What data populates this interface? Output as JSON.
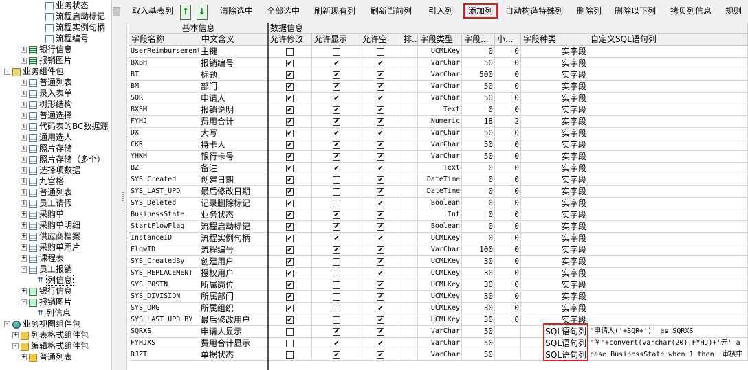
{
  "colors": {
    "highlight_border": "#e02020",
    "header_bg": "#f0f0f0",
    "grid_line": "#d8d8d8",
    "arrow_green": "#1a9a1a"
  },
  "tree": [
    {
      "label": "业务状态",
      "depth": 4,
      "icon": "table-icon",
      "expander": ""
    },
    {
      "label": "流程启动标记",
      "depth": 4,
      "icon": "table-icon",
      "expander": ""
    },
    {
      "label": "流程实例句柄",
      "depth": 4,
      "icon": "table-icon",
      "expander": ""
    },
    {
      "label": "流程编号",
      "depth": 4,
      "icon": "table-icon",
      "expander": ""
    },
    {
      "label": "银行信息",
      "depth": 2,
      "icon": "grid-icon",
      "expander": "+"
    },
    {
      "label": "报销图片",
      "depth": 2,
      "icon": "grid-icon",
      "expander": "+"
    },
    {
      "label": "业务组件包",
      "depth": 0,
      "icon": "package-icon",
      "expander": "-"
    },
    {
      "label": "普通列表",
      "depth": 2,
      "icon": "table-icon",
      "expander": "+"
    },
    {
      "label": "录入表单",
      "depth": 2,
      "icon": "table-icon",
      "expander": "+"
    },
    {
      "label": "树形结构",
      "depth": 2,
      "icon": "table-icon",
      "expander": "+"
    },
    {
      "label": "普通选择",
      "depth": 2,
      "icon": "table-icon",
      "expander": "+"
    },
    {
      "label": "代码表的BC数据源",
      "depth": 2,
      "icon": "table-icon",
      "expander": "+"
    },
    {
      "label": "通用选人",
      "depth": 2,
      "icon": "table-icon",
      "expander": "+"
    },
    {
      "label": "照片存储",
      "depth": 2,
      "icon": "table-icon",
      "expander": "+"
    },
    {
      "label": "照片存储（多个）",
      "depth": 2,
      "icon": "table-icon",
      "expander": "+"
    },
    {
      "label": "选择项数据",
      "depth": 2,
      "icon": "table-icon",
      "expander": "+"
    },
    {
      "label": "九宫格",
      "depth": 2,
      "icon": "table-icon",
      "expander": "+"
    },
    {
      "label": "普通列表",
      "depth": 2,
      "icon": "table-icon",
      "expander": "+"
    },
    {
      "label": "员工请假",
      "depth": 2,
      "icon": "table-icon",
      "expander": "+"
    },
    {
      "label": "采购单",
      "depth": 2,
      "icon": "table-icon",
      "expander": "+"
    },
    {
      "label": "采购单明细",
      "depth": 2,
      "icon": "table-icon",
      "expander": "+"
    },
    {
      "label": "供应商档案",
      "depth": 2,
      "icon": "table-icon",
      "expander": "+"
    },
    {
      "label": "采购单照片",
      "depth": 2,
      "icon": "table-icon",
      "expander": "+"
    },
    {
      "label": "课程表",
      "depth": 2,
      "icon": "table-icon",
      "expander": "+"
    },
    {
      "label": "员工报销",
      "depth": 2,
      "icon": "table-icon",
      "expander": "-"
    },
    {
      "label": "列信息",
      "depth": 3,
      "icon": "column-icon",
      "expander": "",
      "selected": true
    },
    {
      "label": "银行信息",
      "depth": 2,
      "icon": "grid-icon",
      "expander": "+"
    },
    {
      "label": "报销图片",
      "depth": 2,
      "icon": "grid-icon",
      "expander": "-"
    },
    {
      "label": "列信息",
      "depth": 3,
      "icon": "column-icon",
      "expander": ""
    },
    {
      "label": "业务视图组件包",
      "depth": 0,
      "icon": "globe-icon",
      "expander": "-"
    },
    {
      "label": "列表格式组件包",
      "depth": 1,
      "icon": "folder-icon",
      "expander": "+"
    },
    {
      "label": "编辑格式组件包",
      "depth": 1,
      "icon": "folder-icon",
      "expander": "-"
    },
    {
      "label": "普通列表",
      "depth": 2,
      "icon": "folder-icon",
      "expander": "+"
    }
  ],
  "toolbar": {
    "buttons": [
      {
        "label": "取入基表列",
        "name": "fetch-base-columns-button"
      },
      {
        "label": "↑",
        "name": "move-up-arrow-icon",
        "arrow": true
      },
      {
        "label": "↓",
        "name": "move-down-arrow-icon",
        "arrow": true
      },
      {
        "label": "清除选中",
        "name": "clear-selection-button"
      },
      {
        "label": "全部选中",
        "name": "select-all-button"
      },
      {
        "label": "刷新现有列",
        "name": "refresh-existing-columns-button"
      },
      {
        "label": "刷新当前列",
        "name": "refresh-current-column-button"
      },
      {
        "label": "引入列",
        "name": "import-column-button"
      },
      {
        "label": "添加列",
        "name": "add-column-button",
        "highlight": true
      },
      {
        "label": "自动构造特殊列",
        "name": "auto-build-special-columns-button"
      },
      {
        "label": "删除列",
        "name": "delete-column-button"
      },
      {
        "label": "删除以下列",
        "name": "delete-below-columns-button"
      },
      {
        "label": "拷贝列信息",
        "name": "copy-column-info-button"
      },
      {
        "label": "规则",
        "name": "rules-button"
      }
    ]
  },
  "grid": {
    "group_headers": {
      "basic": "基本信息",
      "data": "数据信息"
    },
    "columns": [
      "字段名称",
      "中文含义",
      "允许修改",
      "允许显示",
      "允许空",
      "排...",
      "字段类型",
      "字段...",
      "小...",
      "字段种类",
      "自定义SQL语句列"
    ],
    "rows": [
      {
        "name": "UserReimbursement",
        "cn": "主键",
        "edit": false,
        "show": false,
        "null": false,
        "type": "UCMLKey",
        "len": "0",
        "dec": "0",
        "kind": "实字段",
        "sql": ""
      },
      {
        "name": "BXBH",
        "cn": "报销编号",
        "edit": true,
        "show": true,
        "null": true,
        "type": "VarChar",
        "len": "50",
        "dec": "0",
        "kind": "实字段",
        "sql": ""
      },
      {
        "name": "BT",
        "cn": "标题",
        "edit": true,
        "show": true,
        "null": true,
        "type": "VarChar",
        "len": "500",
        "dec": "0",
        "kind": "实字段",
        "sql": ""
      },
      {
        "name": "BM",
        "cn": "部门",
        "edit": true,
        "show": true,
        "null": true,
        "type": "VarChar",
        "len": "50",
        "dec": "0",
        "kind": "实字段",
        "sql": ""
      },
      {
        "name": "SQR",
        "cn": "申请人",
        "edit": true,
        "show": true,
        "null": true,
        "type": "VarChar",
        "len": "50",
        "dec": "0",
        "kind": "实字段",
        "sql": ""
      },
      {
        "name": "BXSM",
        "cn": "报销说明",
        "edit": true,
        "show": true,
        "null": true,
        "type": "Text",
        "len": "0",
        "dec": "0",
        "kind": "实字段",
        "sql": ""
      },
      {
        "name": "FYHJ",
        "cn": "费用合计",
        "edit": true,
        "show": true,
        "null": true,
        "type": "Numeric",
        "len": "18",
        "dec": "2",
        "kind": "实字段",
        "sql": ""
      },
      {
        "name": "DX",
        "cn": "大写",
        "edit": true,
        "show": true,
        "null": true,
        "type": "VarChar",
        "len": "50",
        "dec": "0",
        "kind": "实字段",
        "sql": ""
      },
      {
        "name": "CKR",
        "cn": "持卡人",
        "edit": true,
        "show": true,
        "null": true,
        "type": "VarChar",
        "len": "50",
        "dec": "0",
        "kind": "实字段",
        "sql": ""
      },
      {
        "name": "YHKH",
        "cn": "银行卡号",
        "edit": true,
        "show": true,
        "null": true,
        "type": "VarChar",
        "len": "50",
        "dec": "0",
        "kind": "实字段",
        "sql": ""
      },
      {
        "name": "BZ",
        "cn": "备注",
        "edit": true,
        "show": true,
        "null": true,
        "type": "Text",
        "len": "0",
        "dec": "0",
        "kind": "实字段",
        "sql": ""
      },
      {
        "name": "SYS_Created",
        "cn": "创建日期",
        "edit": true,
        "show": false,
        "null": true,
        "type": "DateTime",
        "len": "0",
        "dec": "0",
        "kind": "实字段",
        "sql": ""
      },
      {
        "name": "SYS_LAST_UPD",
        "cn": "最后修改日期",
        "edit": true,
        "show": false,
        "null": true,
        "type": "DateTime",
        "len": "0",
        "dec": "0",
        "kind": "实字段",
        "sql": ""
      },
      {
        "name": "SYS_Deleted",
        "cn": "记录删除标记",
        "edit": true,
        "show": false,
        "null": true,
        "type": "Boolean",
        "len": "0",
        "dec": "0",
        "kind": "实字段",
        "sql": ""
      },
      {
        "name": "BusinessState",
        "cn": "业务状态",
        "edit": true,
        "show": true,
        "null": true,
        "type": "Int",
        "len": "0",
        "dec": "0",
        "kind": "实字段",
        "sql": ""
      },
      {
        "name": "StartFlowFlag",
        "cn": "流程启动标记",
        "edit": true,
        "show": true,
        "null": true,
        "type": "Boolean",
        "len": "0",
        "dec": "0",
        "kind": "实字段",
        "sql": ""
      },
      {
        "name": "InstanceID",
        "cn": "流程实例句柄",
        "edit": true,
        "show": true,
        "null": true,
        "type": "UCMLKey",
        "len": "0",
        "dec": "0",
        "kind": "实字段",
        "sql": ""
      },
      {
        "name": "FlowID",
        "cn": "流程编号",
        "edit": true,
        "show": true,
        "null": true,
        "type": "VarChar",
        "len": "100",
        "dec": "0",
        "kind": "实字段",
        "sql": ""
      },
      {
        "name": "SYS_CreatedBy",
        "cn": "创建用户",
        "edit": true,
        "show": false,
        "null": true,
        "type": "UCMLKey",
        "len": "30",
        "dec": "0",
        "kind": "实字段",
        "sql": ""
      },
      {
        "name": "SYS_REPLACEMENT",
        "cn": "授权用户",
        "edit": true,
        "show": false,
        "null": true,
        "type": "UCMLKey",
        "len": "30",
        "dec": "0",
        "kind": "实字段",
        "sql": ""
      },
      {
        "name": "SYS_POSTN",
        "cn": "所属岗位",
        "edit": true,
        "show": false,
        "null": true,
        "type": "UCMLKey",
        "len": "30",
        "dec": "0",
        "kind": "实字段",
        "sql": ""
      },
      {
        "name": "SYS_DIVISION",
        "cn": "所属部门",
        "edit": true,
        "show": false,
        "null": true,
        "type": "UCMLKey",
        "len": "30",
        "dec": "0",
        "kind": "实字段",
        "sql": ""
      },
      {
        "name": "SYS_ORG",
        "cn": "所属组织",
        "edit": true,
        "show": false,
        "null": true,
        "type": "UCMLKey",
        "len": "30",
        "dec": "0",
        "kind": "实字段",
        "sql": ""
      },
      {
        "name": "SYS_LAST_UPD_BY",
        "cn": "最后修改用户",
        "edit": true,
        "show": false,
        "null": true,
        "type": "UCMLKey",
        "len": "30",
        "dec": "0",
        "kind": "实字段",
        "sql": ""
      },
      {
        "name": "SQRXS",
        "cn": "申请人显示",
        "edit": false,
        "show": true,
        "null": true,
        "type": "VarChar",
        "len": "50",
        "dec": "",
        "kind": "SQL语句列",
        "sql": "'申请人('+SQR+')' as SQRXS"
      },
      {
        "name": "FYHJXS",
        "cn": "费用合计显示",
        "edit": false,
        "show": true,
        "null": true,
        "type": "VarChar",
        "len": "50",
        "dec": "",
        "kind": "SQL语句列",
        "sql": "'￥'+convert(varchar(20),FYHJ)+'元' a"
      },
      {
        "name": "DJZT",
        "cn": "单据状态",
        "edit": false,
        "show": true,
        "null": true,
        "type": "VarChar",
        "len": "50",
        "dec": "",
        "kind": "SQL语句列",
        "sql": "case BusinessState when 1 then '审核中"
      }
    ]
  }
}
